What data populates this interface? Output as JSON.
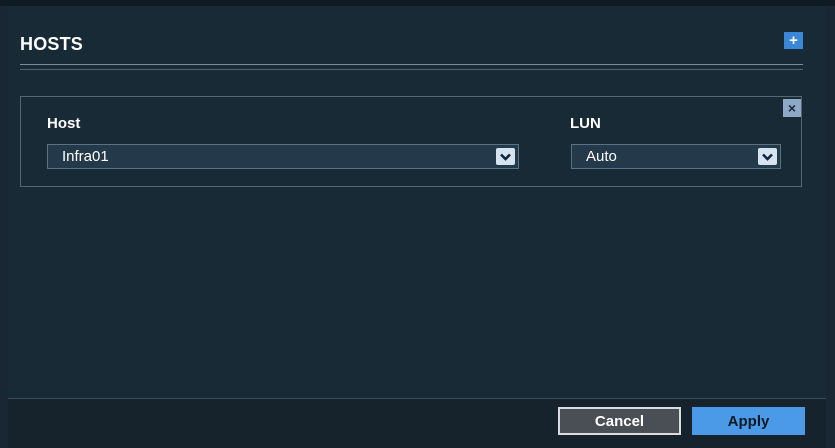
{
  "hosts_section": {
    "title": "HOSTS",
    "add_icon": "plus-icon",
    "remove_icon": "close-icon"
  },
  "host_entry": {
    "host_label": "Host",
    "host_value": "Infra01",
    "lun_label": "LUN",
    "lun_value": "Auto"
  },
  "footer": {
    "cancel_label": "Cancel",
    "apply_label": "Apply"
  },
  "colors": {
    "background": "#192a37",
    "accent": "#4a9ae8"
  }
}
